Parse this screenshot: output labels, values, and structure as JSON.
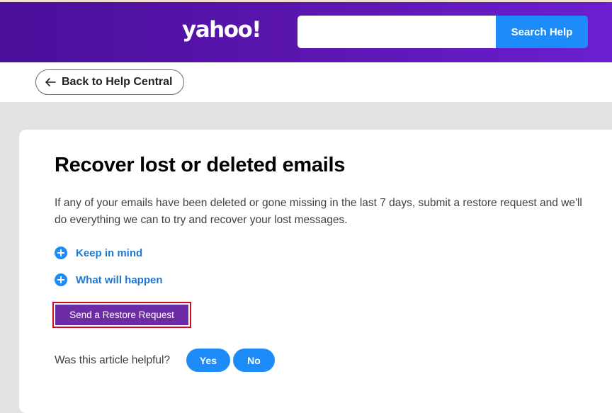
{
  "header": {
    "logo_text": "yahoo!",
    "search": {
      "value": "",
      "placeholder": ""
    },
    "search_button_label": "Search Help"
  },
  "nav": {
    "back_label": "Back to Help Central",
    "back_icon": "arrow-left-icon"
  },
  "article": {
    "title": "Recover lost or deleted emails",
    "description": "If any of your emails have been deleted or gone missing in the last 7 days, submit a restore request and we'll do everything we can to try and recover your lost messages.",
    "accordions": [
      {
        "label": "Keep in mind",
        "icon": "plus-circle-icon"
      },
      {
        "label": "What will happen",
        "icon": "plus-circle-icon"
      }
    ],
    "restore_button_label": "Send a Restore Request"
  },
  "feedback": {
    "question": "Was this article helpful?",
    "yes_label": "Yes",
    "no_label": "No"
  },
  "colors": {
    "header_gradient_start": "#4a0f9b",
    "header_gradient_end": "#6b1fd0",
    "accent_blue": "#1d8cf8",
    "link_blue": "#1d78d8",
    "restore_purple": "#6e2ba6",
    "highlight_red": "#d20a1e",
    "page_background": "#e2e2e2"
  }
}
